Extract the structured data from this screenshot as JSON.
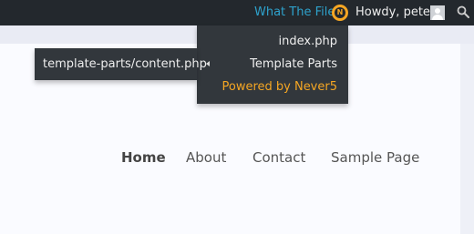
{
  "admin_bar": {
    "plugin_label": "What The File",
    "greeting": "Howdy, peter",
    "search_icon": "search-icon",
    "avatar_icon": "user-avatar-icon",
    "plugin_logo_icon": "never5-logo-icon"
  },
  "dropdown": {
    "items": [
      {
        "label": "index.php"
      },
      {
        "label": "Template Parts"
      },
      {
        "label": "Powered by Never5"
      }
    ],
    "submenu": {
      "items": [
        {
          "label": "template-parts/content.php"
        }
      ]
    }
  },
  "nav": {
    "items": [
      {
        "label": "Home"
      },
      {
        "label": "About"
      },
      {
        "label": "Contact"
      },
      {
        "label": "Sample Page"
      }
    ]
  },
  "colors": {
    "admin_bar_bg": "#23282d",
    "menu_bg": "#32373c",
    "plugin_accent": "#2ea2cc",
    "powered_accent": "#f5a623"
  }
}
